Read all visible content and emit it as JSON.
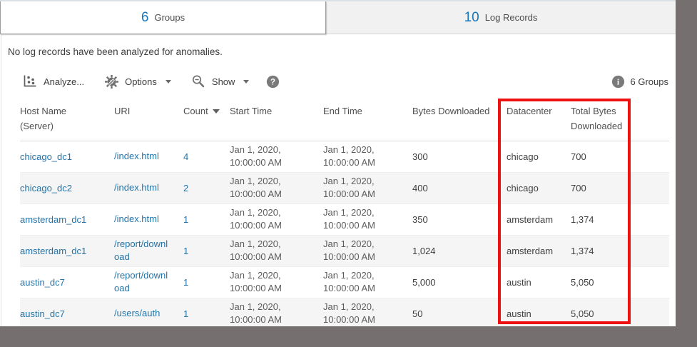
{
  "tabs": [
    {
      "count": "6",
      "label": "Groups"
    },
    {
      "count": "10",
      "label": "Log Records"
    }
  ],
  "message": "No log records have been analyzed for anomalies.",
  "toolbar": {
    "analyze_label": "Analyze...",
    "options_label": "Options",
    "show_label": "Show",
    "groups_summary": "6 Groups"
  },
  "icons": {
    "analyze": "scatter-plot-icon",
    "options": "gear-pencil-icon",
    "show": "zoom-out-magnifier-icon",
    "help": "question-circle-icon",
    "summary": "info-circle-icon",
    "sort": "caret-down-icon",
    "dropdown": "caret-down-icon"
  },
  "colors": {
    "accent_blue": "#1677bd",
    "link_blue": "#2373a8",
    "highlight_red": "#ee1111",
    "surround_gray": "#75706f",
    "row_alt": "#f5f5f5"
  },
  "table": {
    "headers": {
      "host": "Host Name\n(Server)",
      "uri": "URI",
      "count": "Count",
      "start": "Start Time",
      "end": "End Time",
      "bytes": "Bytes Downloaded",
      "datacenter": "Datacenter",
      "total": "Total Bytes\nDownloaded"
    },
    "rows": [
      {
        "host": "chicago_dc1",
        "uri": "/index.html",
        "count": "4",
        "start": "Jan 1, 2020,\n10:00:00 AM",
        "end": "Jan 1, 2020,\n10:00:00 AM",
        "bytes": "300",
        "datacenter": "chicago",
        "total": "700"
      },
      {
        "host": "chicago_dc2",
        "uri": "/index.html",
        "count": "2",
        "start": "Jan 1, 2020,\n10:00:00 AM",
        "end": "Jan 1, 2020,\n10:00:00 AM",
        "bytes": "400",
        "datacenter": "chicago",
        "total": "700"
      },
      {
        "host": "amsterdam_dc1",
        "uri": "/index.html",
        "count": "1",
        "start": "Jan 1, 2020,\n10:00:00 AM",
        "end": "Jan 1, 2020,\n10:00:00 AM",
        "bytes": "350",
        "datacenter": "amsterdam",
        "total": "1,374"
      },
      {
        "host": "amsterdam_dc1",
        "uri": "/report/download",
        "count": "1",
        "start": "Jan 1, 2020,\n10:00:00 AM",
        "end": "Jan 1, 2020,\n10:00:00 AM",
        "bytes": "1,024",
        "datacenter": "amsterdam",
        "total": "1,374"
      },
      {
        "host": "austin_dc7",
        "uri": "/report/download",
        "count": "1",
        "start": "Jan 1, 2020,\n10:00:00 AM",
        "end": "Jan 1, 2020,\n10:00:00 AM",
        "bytes": "5,000",
        "datacenter": "austin",
        "total": "5,050"
      },
      {
        "host": "austin_dc7",
        "uri": "/users/auth",
        "count": "1",
        "start": "Jan 1, 2020,\n10:00:00 AM",
        "end": "Jan 1, 2020,\n10:00:00 AM",
        "bytes": "50",
        "datacenter": "austin",
        "total": "5,050"
      }
    ]
  }
}
